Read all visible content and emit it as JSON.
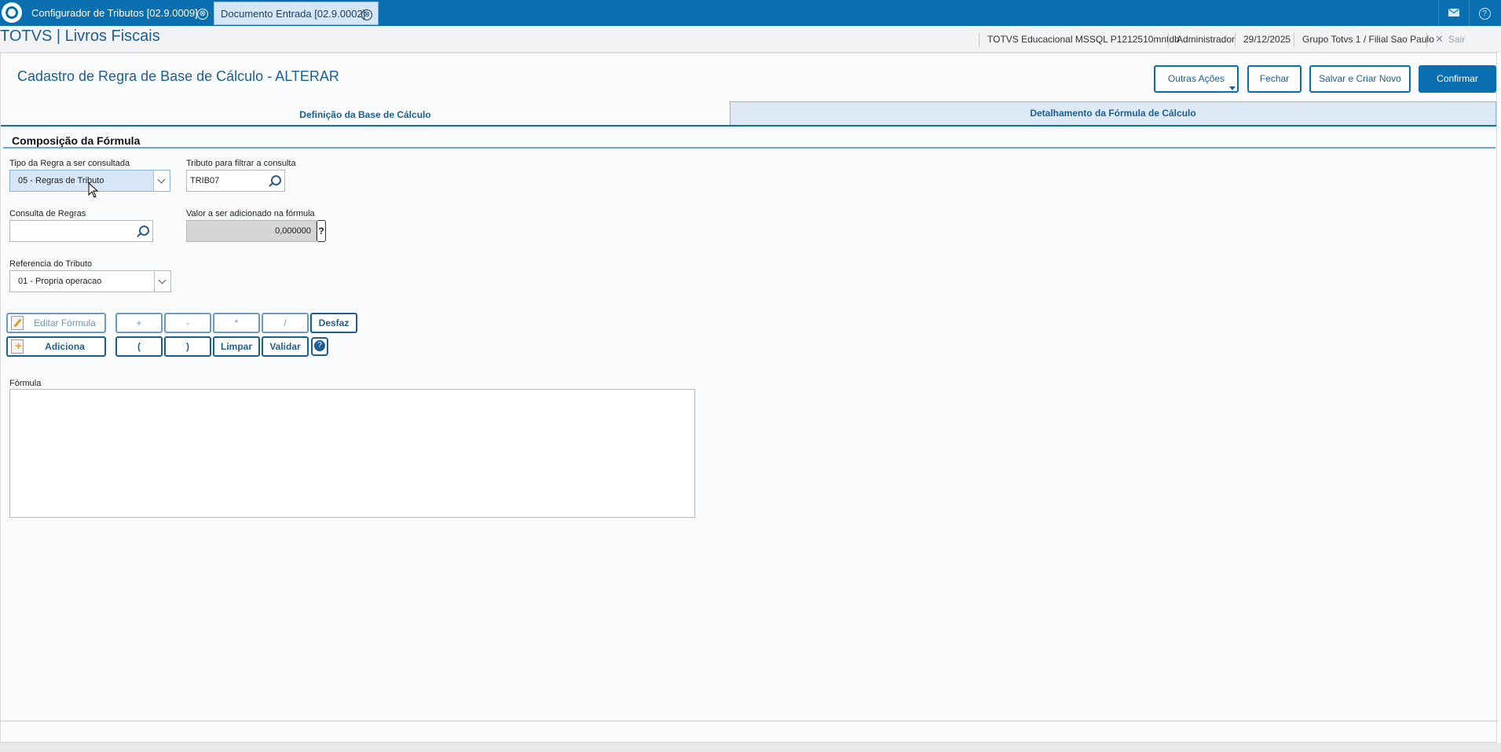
{
  "topbar": {
    "tabs": [
      {
        "label": "Configurador de Tributos [02.9.0009]"
      },
      {
        "label": "Documento Entrada [02.9.0002]"
      }
    ],
    "icons": [
      "totvs-logo-icon",
      "mail-icon",
      "help-icon",
      "close-icon"
    ],
    "close_glyph": "⊗",
    "help_glyph": "?"
  },
  "header": {
    "app_title": "TOTVS | Livros Fiscais",
    "environment": "TOTVS Educacional MSSQL P1212510mntdb",
    "user": "Administrador",
    "date": "29/12/2025",
    "branch": "Grupo Totvs 1 / Filial Sao Paulo",
    "logout": "Sair"
  },
  "page": {
    "title": "Cadastro de Regra de Base de Cálculo - ALTERAR",
    "actions": {
      "outras": "Outras Ações",
      "fechar": "Fechar",
      "salvar": "Salvar e Criar Novo",
      "confirmar": "Confirmar"
    },
    "tabs": [
      {
        "label": "Definição da Base de Cálculo",
        "active": false
      },
      {
        "label": "Detalhamento da Fórmula de Cálculo",
        "active": true
      }
    ],
    "section_title": "Composição da Fórmula"
  },
  "form": {
    "tipo_regra": {
      "label": "Tipo da Regra a ser consultada",
      "value": "05 - Regras de Tributo"
    },
    "tributo_filtro": {
      "label": "Tributo para filtrar a consulta",
      "value": "TRIB07"
    },
    "consulta_regras": {
      "label": "Consulta de Regras",
      "value": ""
    },
    "valor_adicionado": {
      "label": "Valor a ser adicionado na fórmula",
      "value": "0,000000",
      "help": "?"
    },
    "referencia": {
      "label": "Referencia do Tributo",
      "value": "01 - Propria operacao"
    },
    "formula": {
      "label": "Fórmula",
      "value": ""
    }
  },
  "calculator": {
    "editar": "Editar Fórmula",
    "adiciona": "Adiciona",
    "plus": "+",
    "minus": "-",
    "times": "*",
    "divide": "/",
    "desfaz": "Desfaz",
    "open_paren": "(",
    "close_paren": ")",
    "limpar": "Limpar",
    "validar": "Validar",
    "help": "?"
  },
  "colors": {
    "brand_blue": "#0a6fb0",
    "tab_active_bg": "#dde9f5",
    "readonly_bg": "#d5d5d5"
  }
}
